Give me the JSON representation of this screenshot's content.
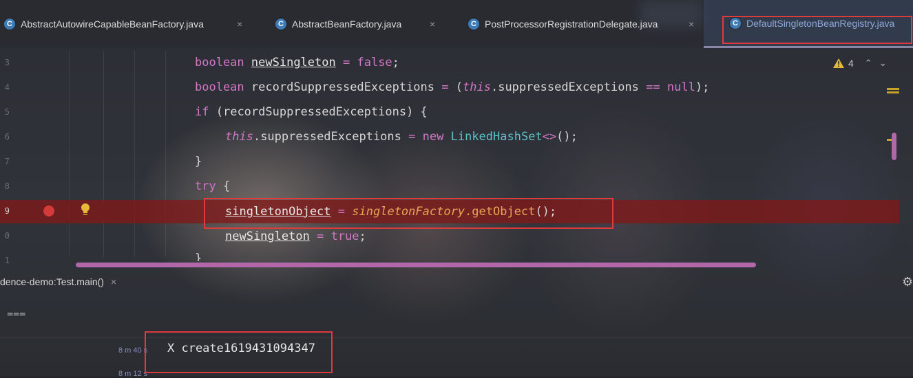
{
  "tabs": [
    {
      "label": "AbstractAutowireCapableBeanFactory.java",
      "icon": "class-icon",
      "close": "×"
    },
    {
      "label": "AbstractBeanFactory.java",
      "icon": "class-icon",
      "close": "×"
    },
    {
      "label": "PostProcessorRegistrationDelegate.java",
      "icon": "class-icon",
      "close": "×"
    },
    {
      "label": "DefaultSingletonBeanRegistry.java",
      "icon": "class-icon",
      "active": true
    }
  ],
  "gutter": {
    "line_numbers": [
      "3",
      "4",
      "5",
      "6",
      "7",
      "8",
      "9",
      "0",
      "1"
    ]
  },
  "code": {
    "line1": {
      "kw": "boolean",
      "var": "newSingleton",
      "op": "=",
      "val": "false",
      "end": ";"
    },
    "line2": {
      "kw": "boolean",
      "name": "recordSuppressedExceptions",
      "op": "=",
      "open": "(",
      "this": "this",
      "field": ".suppressedExceptions",
      "eq": "==",
      "null": "null",
      "end": ");"
    },
    "line3": {
      "kw": "if",
      "text": "(recordSuppressedExceptions) {"
    },
    "line4": {
      "this": "this",
      "field": ".suppressedExceptions",
      "op": "=",
      "new": "new",
      "cls": "LinkedHashSet",
      "diamond": "<>",
      "end": "();"
    },
    "line5": {
      "text": "}"
    },
    "line6": {
      "kw": "try",
      "text": "{"
    },
    "line7": {
      "var": "singletonObject",
      "op": "=",
      "factory": "singletonFactory",
      "method": ".getObject",
      "end": "();"
    },
    "line8": {
      "var": "newSingleton",
      "op": "=",
      "val": "true",
      "end": ";"
    },
    "line9": {
      "text": "}"
    }
  },
  "inspection": {
    "warning_count": "4",
    "up": "⌃",
    "down": "⌄"
  },
  "run": {
    "config_label": "dence-demo:Test.main()",
    "close": "×",
    "console_lines": [
      {
        "time": "8 m 40 s",
        "text": "X create1619431094347"
      },
      {
        "time": "8 m 12 s",
        "text": ""
      }
    ]
  },
  "colors": {
    "highlight": "#e03b3b",
    "breakpoint": "#d33a3a",
    "scrollbar": "#b267a8"
  }
}
